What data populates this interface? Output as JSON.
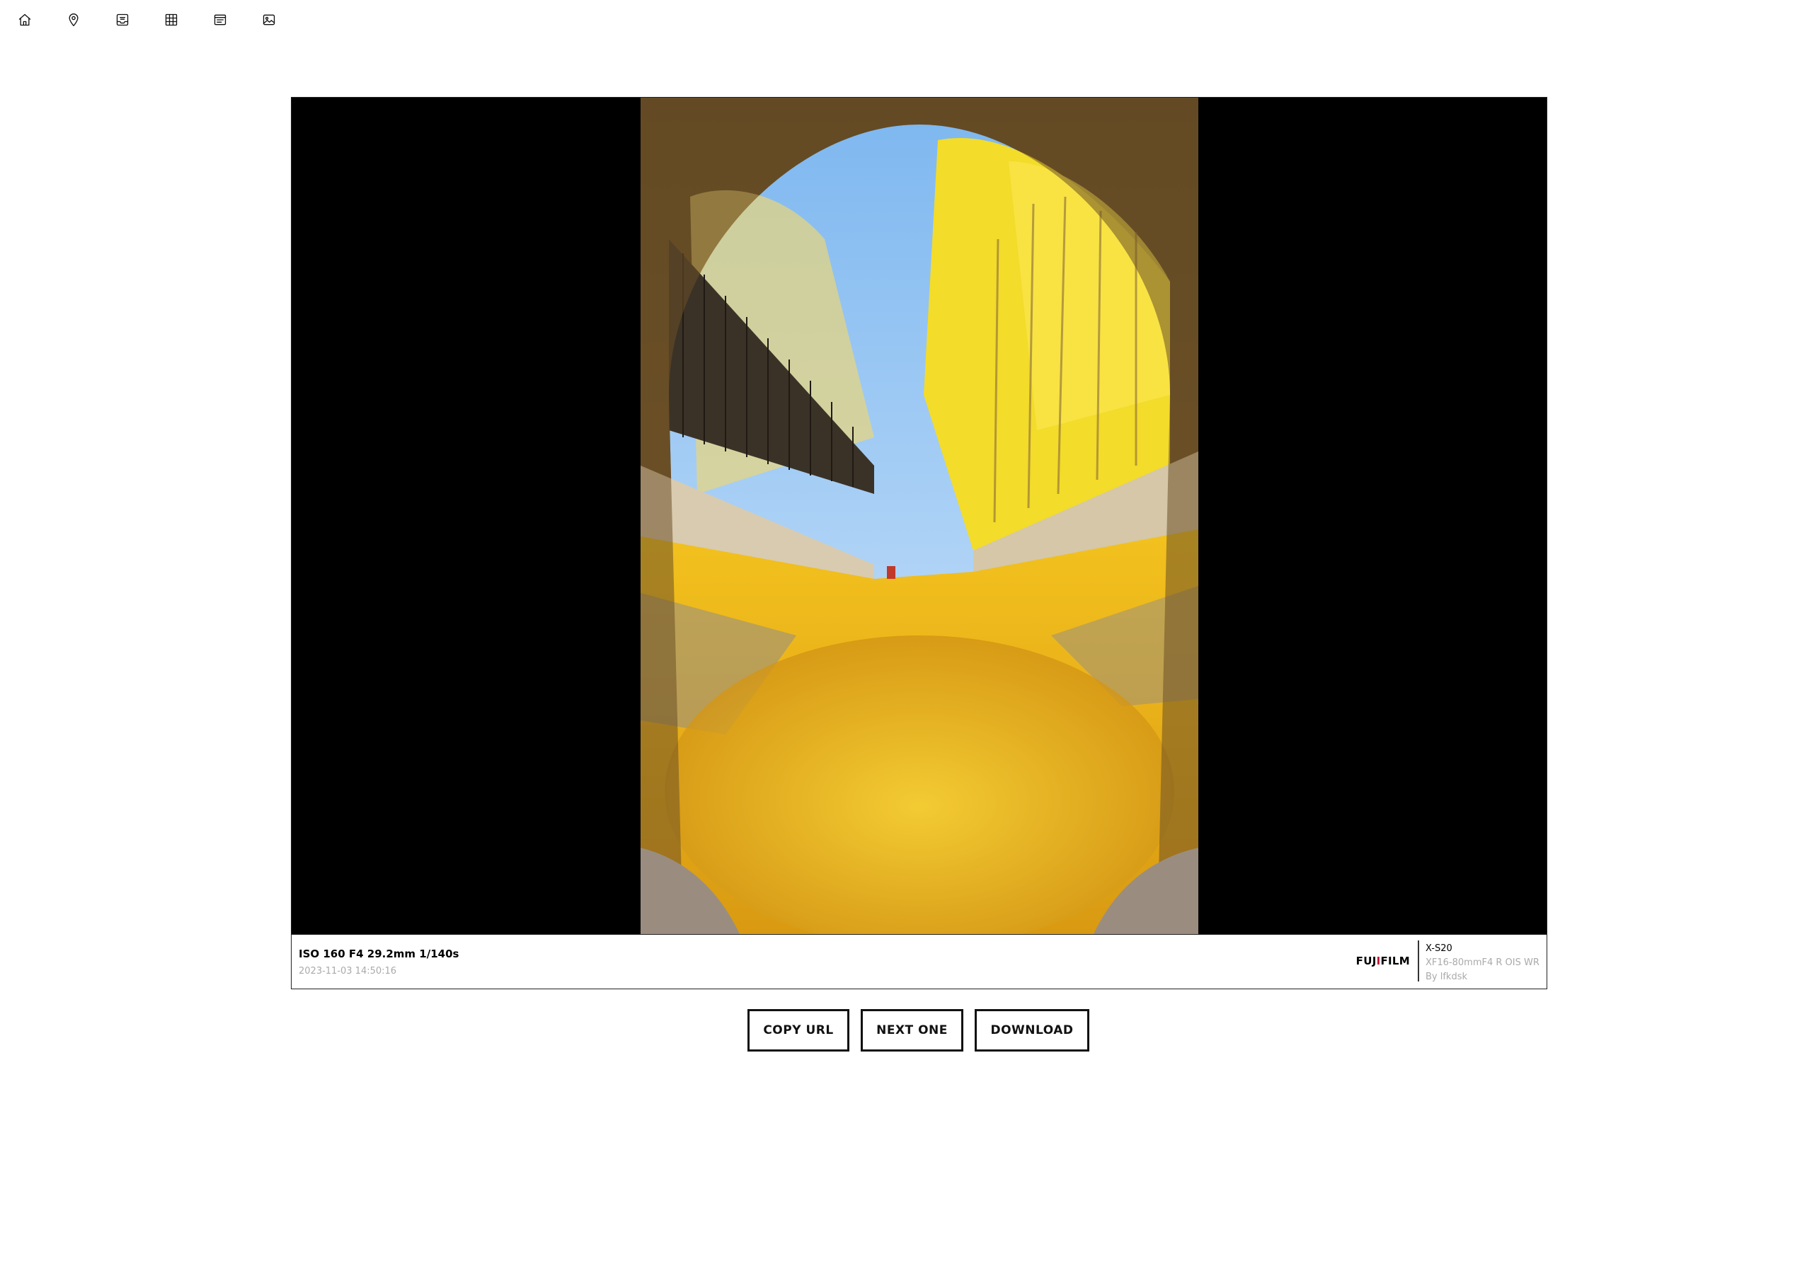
{
  "nav": {
    "icons": [
      "home-icon",
      "map-pin-icon",
      "inbox-icon",
      "grid-icon",
      "list-icon",
      "image-icon"
    ]
  },
  "photo": {
    "exif": "ISO 160 F4 29.2mm 1/140s",
    "datetime": "2023-11-03 14:50:16",
    "brand_prefix": "FUJ",
    "brand_accent": "I",
    "brand_suffix": "FILM",
    "camera_model": "X-S20",
    "lens_model": "XF16-80mmF4 R OIS WR",
    "author": "By lfkdsk"
  },
  "actions": {
    "copy_url": "COPY URL",
    "next_one": "NEXT ONE",
    "download": "DOWNLOAD"
  },
  "colors": {
    "background": "#ffffff",
    "stage": "#000000",
    "brand_accent": "#c8102e",
    "muted_text": "#aaaaaa"
  }
}
